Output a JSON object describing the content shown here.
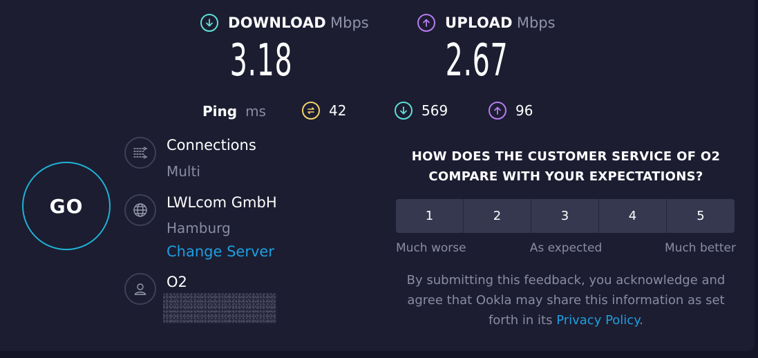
{
  "download": {
    "label": "DOWNLOAD",
    "unit": "Mbps",
    "value": "3.18",
    "icon": "download-arrow-icon",
    "color": "#5ee0d8"
  },
  "upload": {
    "label": "UPLOAD",
    "unit": "Mbps",
    "value": "2.67",
    "icon": "upload-arrow-icon",
    "color": "#b77cf2"
  },
  "ping": {
    "label": "Ping",
    "unit": "ms",
    "idle": {
      "value": "42",
      "icon": "ping-idle-icon",
      "color": "#f3d36b"
    },
    "download": {
      "value": "569",
      "icon": "ping-download-icon",
      "color": "#5ee0d8"
    },
    "upload": {
      "value": "96",
      "icon": "ping-upload-icon",
      "color": "#b77cf2"
    }
  },
  "go_button": {
    "label": "GO",
    "color": "#1fb3d6"
  },
  "connections": {
    "title": "Connections",
    "value": "Multi",
    "icon": "connections-icon"
  },
  "server": {
    "name": "LWLcom GmbH",
    "location": "Hamburg",
    "change_label": "Change Server",
    "icon": "globe-icon"
  },
  "provider": {
    "name": "O2",
    "icon": "user-icon"
  },
  "survey": {
    "question_line1": "HOW DOES THE CUSTOMER SERVICE OF O2",
    "question_line2": "COMPARE WITH YOUR EXPECTATIONS?",
    "ratings": [
      "1",
      "2",
      "3",
      "4",
      "5"
    ],
    "scale_low": "Much worse",
    "scale_mid": "As expected",
    "scale_high": "Much better",
    "disclaimer_line1": "By submitting this feedback, you acknowledge and",
    "disclaimer_line2": "agree that Ookla may share this information as set",
    "disclaimer_line3_prefix": "forth in its ",
    "privacy_link": "Privacy Policy",
    "disclaimer_suffix": "."
  }
}
